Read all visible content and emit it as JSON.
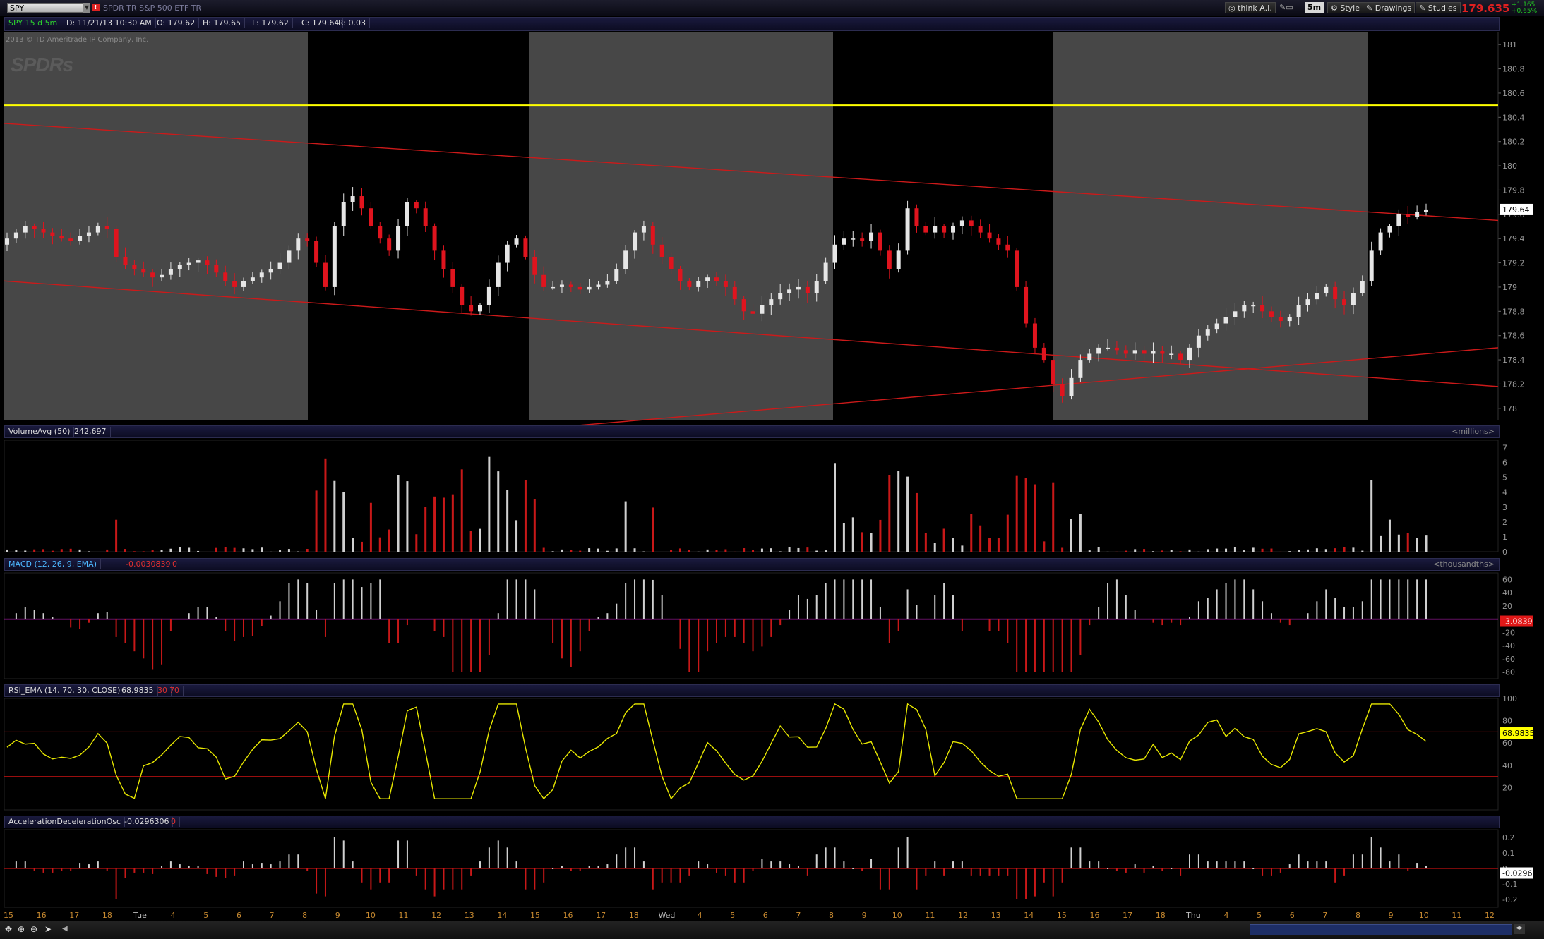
{
  "toolbar": {
    "symbol": "SPY",
    "symbol_flag": "!",
    "description": "SPDR TR S&P 500 ETF TR",
    "think": "think A.I.",
    "interval_button": "5m",
    "style": "Style",
    "drawings": "Drawings",
    "studies": "Studies",
    "last_price": "179.635",
    "change_top": "+1.165",
    "change_bottom": "+0.65%"
  },
  "price_header": {
    "symbol_period": "SPY 15 d 5m",
    "date": "D: 11/21/13 10:30 AM",
    "open": "O: 179.62",
    "high": "H: 179.65",
    "low": "L: 179.62",
    "close": "C: 179.64",
    "range": "R: 0.03"
  },
  "watermark": "SPDRs",
  "copyright": "2013 © TD Ameritrade IP Company, Inc.",
  "volume_header": {
    "study": "VolumeAvg (50)",
    "value": "242,697",
    "units": "<millions>"
  },
  "macd_header": {
    "study": "MACD (12, 26, 9, EMA)",
    "value": "-0.0030839",
    "zero": "0",
    "units": "<thousandths>"
  },
  "rsi_header": {
    "study": "RSI_EMA (14, 70, 30, CLOSE)",
    "value": "68.9835",
    "ob": "30",
    "os": "70"
  },
  "ac_header": {
    "study": "AccelerationDecelerationOsc",
    "value": "-0.0296306",
    "zero": "0"
  },
  "chart_data": [
    {
      "type": "candlestick",
      "title": "SPY 15 d 5m",
      "ylim": [
        177.9,
        181.1
      ],
      "yticks": [
        "181",
        "180.8",
        "180.6",
        "180.4",
        "180.2",
        "180",
        "179.8",
        "179.6",
        "179.4",
        "179.2",
        "179",
        "178.8",
        "178.6",
        "178.4",
        "178.2",
        "178"
      ],
      "last_label": "179.64",
      "horizontal_line": 180.5,
      "closes": [
        179.4,
        179.45,
        179.5,
        179.48,
        179.45,
        179.42,
        179.4,
        179.38,
        179.42,
        179.45,
        179.5,
        179.48,
        179.25,
        179.18,
        179.15,
        179.12,
        179.08,
        179.1,
        179.15,
        179.18,
        179.2,
        179.22,
        179.18,
        179.12,
        179.05,
        179.0,
        179.05,
        179.08,
        179.12,
        179.15,
        179.2,
        179.3,
        179.4,
        179.38,
        179.2,
        179.0,
        179.5,
        179.7,
        179.75,
        179.65,
        179.5,
        179.4,
        179.3,
        179.5,
        179.7,
        179.65,
        179.5,
        179.3,
        179.15,
        179.0,
        178.85,
        178.8,
        178.85,
        179.0,
        179.2,
        179.35,
        179.4,
        179.25,
        179.1,
        179.0,
        179.0,
        179.02,
        179.0,
        178.98,
        179.0,
        179.02,
        179.05,
        179.15,
        179.3,
        179.45,
        179.5,
        179.35,
        179.25,
        179.15,
        179.05,
        179.0,
        179.05,
        179.08,
        179.05,
        179.0,
        178.9,
        178.8,
        178.78,
        178.85,
        178.9,
        178.95,
        178.98,
        179.0,
        178.95,
        179.05,
        179.2,
        179.35,
        179.4,
        179.4,
        179.38,
        179.45,
        179.3,
        179.15,
        179.3,
        179.65,
        179.5,
        179.45,
        179.5,
        179.45,
        179.5,
        179.55,
        179.5,
        179.45,
        179.4,
        179.35,
        179.3,
        179.0,
        178.7,
        178.5,
        178.4,
        178.2,
        178.1,
        178.25,
        178.4,
        178.45,
        178.5,
        178.5,
        178.48,
        178.45,
        178.48,
        178.45,
        178.47,
        178.45,
        178.45,
        178.4,
        178.5,
        178.6,
        178.65,
        178.7,
        178.75,
        178.8,
        178.85,
        178.85,
        178.8,
        178.75,
        178.72,
        178.75,
        178.85,
        178.9,
        178.95,
        179.0,
        178.9,
        178.85,
        178.95,
        179.05,
        179.3,
        179.45,
        179.5,
        179.6,
        179.58,
        179.62,
        179.64
      ],
      "volume_ylim": [
        0,
        7.5
      ],
      "volume_yticks": [
        "7",
        "6",
        "5",
        "4",
        "3",
        "2",
        "1",
        "0"
      ],
      "macd_yticks": [
        "60",
        "40",
        "20",
        "0",
        "-20",
        "-40",
        "-60",
        "-80"
      ],
      "macd_ylim": [
        -90,
        70
      ],
      "macd_last": "-3.0839",
      "rsi_yticks": [
        "100",
        "80",
        "60",
        "40",
        "20"
      ],
      "rsi_ylim": [
        0,
        100
      ],
      "rsi_levels": [
        70,
        30
      ],
      "rsi_last": "68.9835",
      "ac_yticks": [
        "0.2",
        "0.1",
        "0",
        "-0.1",
        "-0.2"
      ],
      "ac_ylim": [
        -0.25,
        0.25
      ],
      "ac_last": "-0.0296",
      "x_labels": [
        "15",
        "16",
        "17",
        "18",
        "Tue",
        "4",
        "5",
        "6",
        "7",
        "8",
        "9",
        "10",
        "11",
        "12",
        "13",
        "14",
        "15",
        "16",
        "17",
        "18",
        "Wed",
        "4",
        "5",
        "6",
        "7",
        "8",
        "9",
        "10",
        "11",
        "12",
        "13",
        "14",
        "15",
        "16",
        "17",
        "18",
        "Thu",
        "4",
        "5",
        "6",
        "7",
        "8",
        "9",
        "10",
        "11",
        "12"
      ]
    }
  ]
}
